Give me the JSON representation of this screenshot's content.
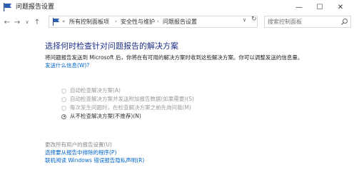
{
  "window": {
    "title": "问题报告设置",
    "minimize": "—",
    "maximize": "☐",
    "close": "✕"
  },
  "nav": {
    "back": "←",
    "forward": "→",
    "down": "∨",
    "up": "↑"
  },
  "address": {
    "chevron": "«",
    "crumbs": [
      "所有控制面板项",
      "安全性与维护",
      "问题报告设置"
    ],
    "separator": "›",
    "dropdown": "∨",
    "refresh": "↻"
  },
  "search": {
    "placeholder": "搜索控制面板"
  },
  "main": {
    "heading": "选择何时检查针对问题报告的解决方案",
    "description": "将问题报告发送到 Microsoft 后，你将在有可用的解决方案时收到这些解决方案。你可以调整发送的信息量。",
    "more_info_link": "发送什么信息(W)?",
    "options": [
      {
        "label": "自动检查解决方案(A)",
        "checked": false
      },
      {
        "label": "自动检查解决方案并发送附加报告数据(如果需要)(S)",
        "checked": false
      },
      {
        "label": "每次发生问题时，在检查解决方案之前先询问我(M)",
        "checked": false
      },
      {
        "label": "从不检查解决方案(不推荐)(N)",
        "checked": true
      }
    ],
    "all_users_text": "更改所有用户的报告设置(U)",
    "exclude_programs_link": "选择要从报告中排除的程序(P)",
    "privacy_link": "联机阅读 Windows 错误报告隐私声明(R)"
  },
  "colors": {
    "heading": "#1e3287",
    "link": "#0066cc",
    "disabled": "#9a9a9a"
  }
}
